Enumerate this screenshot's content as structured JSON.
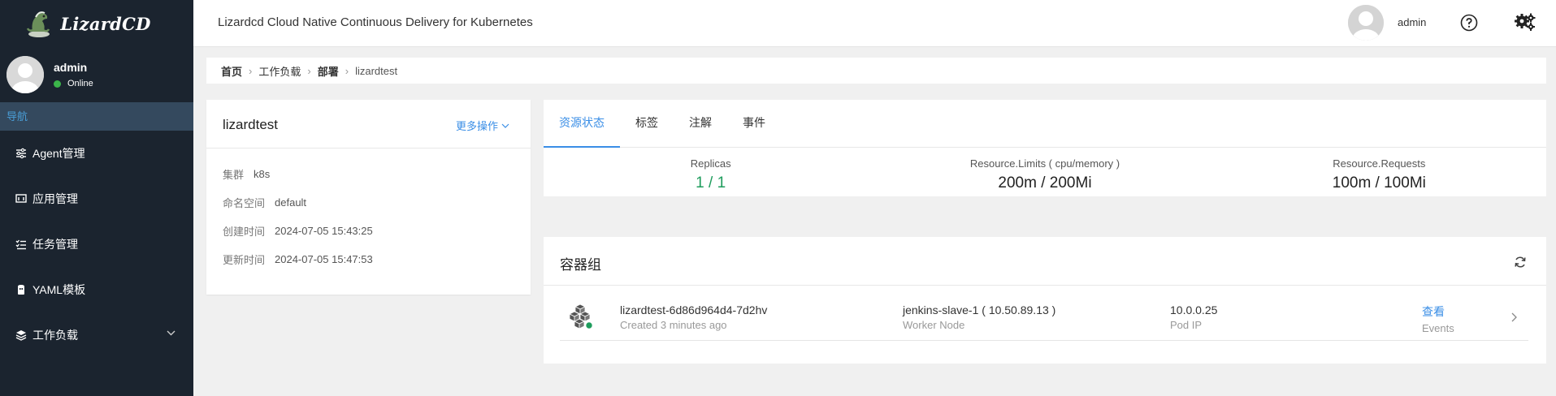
{
  "brand": {
    "name": "LizardCD"
  },
  "sidebar": {
    "user": {
      "name": "admin",
      "status": "Online"
    },
    "nav_header": "导航",
    "items": [
      {
        "label": "Agent管理",
        "icon": "sliders-icon"
      },
      {
        "label": "应用管理",
        "icon": "app-window-icon"
      },
      {
        "label": "任务管理",
        "icon": "task-list-icon"
      },
      {
        "label": "YAML模板",
        "icon": "template-icon"
      },
      {
        "label": "工作负载",
        "icon": "layers-icon"
      }
    ]
  },
  "header": {
    "title": "Lizardcd Cloud Native Continuous Delivery for Kubernetes",
    "user": "admin"
  },
  "breadcrumb": [
    "首页",
    "工作负载",
    "部署",
    "lizardtest"
  ],
  "info_card": {
    "title": "lizardtest",
    "more_ops": "更多操作",
    "rows": [
      {
        "label": "集群",
        "value": "k8s"
      },
      {
        "label": "命名空间",
        "value": "default"
      },
      {
        "label": "创建时间",
        "value": "2024-07-05 15:43:25"
      },
      {
        "label": "更新时间",
        "value": "2024-07-05 15:47:53"
      }
    ]
  },
  "tabs": [
    "资源状态",
    "标签",
    "注解",
    "事件"
  ],
  "stats": [
    {
      "label": "Replicas",
      "value": "1 / 1"
    },
    {
      "label": "Resource.Limits ( cpu/memory )",
      "value": "200m / 200Mi"
    },
    {
      "label": "Resource.Requests",
      "value": "100m / 100Mi"
    }
  ],
  "containers": {
    "title": "容器组",
    "pod": {
      "name": "lizardtest-6d86d964d4-7d2hv",
      "created": "Created 3 minutes ago",
      "node": "jenkins-slave-1 ( 10.50.89.13 )",
      "node_label": "Worker Node",
      "ip": "10.0.0.25",
      "ip_label": "Pod IP",
      "view": "查看",
      "events": "Events"
    }
  },
  "colors": {
    "accent": "#3a8ee6",
    "sidebar_bg": "#1b242f",
    "online": "#3bb54a",
    "replica_green": "#1e9c5c"
  }
}
